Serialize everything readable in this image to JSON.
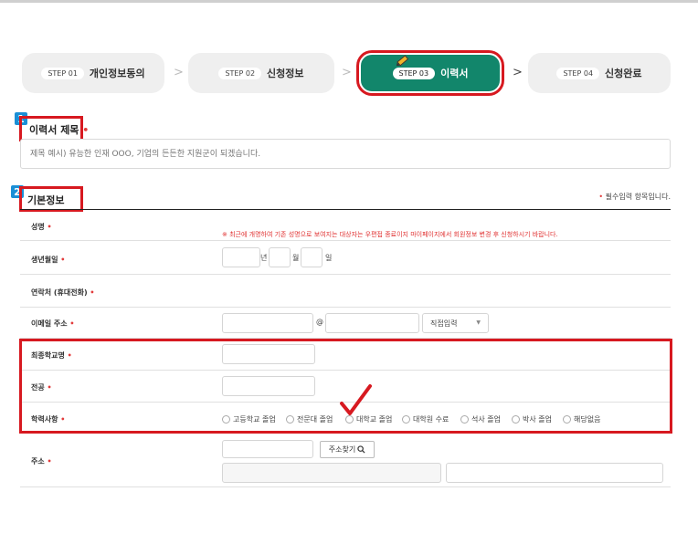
{
  "steps": [
    {
      "num": "STEP 01",
      "label": "개인정보동의"
    },
    {
      "num": "STEP 02",
      "label": "신청정보"
    },
    {
      "num": "STEP 03",
      "label": "이력서"
    },
    {
      "num": "STEP 04",
      "label": "신청완료"
    }
  ],
  "arrow": ">",
  "annotations": {
    "badge1": "1",
    "badge2": "2"
  },
  "resume_title": {
    "heading": "이력서 제목",
    "required_mark": "•",
    "placeholder": "제목 예시) 유능한 인재 OOO, 기업의 든든한 지원군이 되겠습니다."
  },
  "basic_info": {
    "heading": "기본정보",
    "required_note_mark": "•",
    "required_note": "필수입력 항목입니다.",
    "notice": "※ 최근에 개명하여 기존 성명으로 보여지는 대상자는 우편접 종료이지 마이페이지에서 회원정보 변경 후 신청하시기 바랍니다.",
    "fields": {
      "name": "성명",
      "birth": "생년월일",
      "phone": "연락처 (휴대전화)",
      "email": "이메일 주소",
      "school": "최종학교명",
      "major": "전공",
      "education": "학력사항",
      "address": "주소"
    },
    "birth_units": {
      "year": "년",
      "month": "월",
      "day": "일"
    },
    "email_at": "@",
    "email_select": "직접입력",
    "education_options": [
      "고등학교 졸업",
      "전문대 졸업",
      "대학교 졸업",
      "대학원 수료",
      "석사 졸업",
      "박사 졸업",
      "해당없음"
    ],
    "address_button": "주소찾기",
    "req_mark": "•"
  },
  "colors": {
    "accent": "#12866b",
    "annotation": "#d71920",
    "badge": "#1a8fd6",
    "required": "#e23b3b"
  }
}
